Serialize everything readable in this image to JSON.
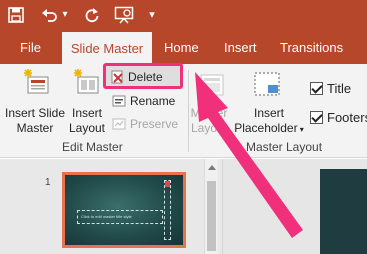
{
  "qat": {
    "save_icon": "save-icon",
    "undo_icon": "undo-icon",
    "undo_dropdown": "▾",
    "redo_icon": "redo-icon",
    "present_icon": "present-from-beginning-icon",
    "customize": "▾"
  },
  "tabs": [
    "File",
    "Slide Master",
    "Home",
    "Insert",
    "Transitions"
  ],
  "active_tab": "Slide Master",
  "ribbon": {
    "edit_master": {
      "insert_slide_master": [
        "Insert Slide",
        "Master"
      ],
      "insert_layout": [
        "Insert",
        "Layout"
      ],
      "delete": "Delete",
      "rename": "Rename",
      "preserve": "Preserve",
      "group_label": "Edit Master"
    },
    "master_layout": {
      "master_layout_btn": [
        "Master",
        "Layout"
      ],
      "insert_placeholder": [
        "Insert",
        "Placeholder"
      ],
      "title_checkbox": "Title",
      "footers_checkbox": "Footers",
      "group_label": "Master Layout"
    }
  },
  "thumbnail": {
    "number": "1",
    "placeholder_text": "Click to edit master title style"
  },
  "colors": {
    "brand": "#b7472a",
    "highlight": "#f0307a",
    "thumb_border": "#e8714f"
  }
}
